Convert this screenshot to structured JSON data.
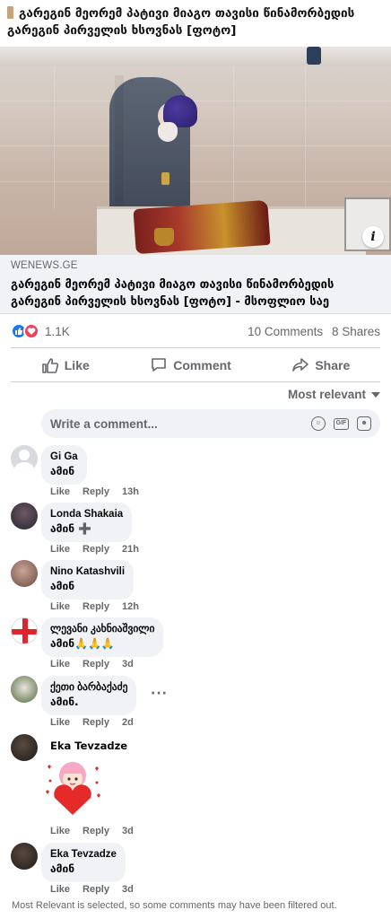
{
  "post": {
    "title": "გარეგინ მეორემ პატივი მიაგო თავისი წინამორბედის გარეგინ პირველის ხსოვნას [ფოტო]",
    "info_label": "i"
  },
  "link": {
    "domain": "WENEWS.GE",
    "title": "გარეგინ მეორემ პატივი მიაგო თავისი წინამორბედის გარეგინ პირველის ხსოვნას [ფოტო] - მსოფლიო საე"
  },
  "stats": {
    "reactions_count": "1.1K",
    "comments": "10 Comments",
    "shares": "8 Shares"
  },
  "actions": {
    "like": "Like",
    "comment": "Comment",
    "share": "Share"
  },
  "sort": {
    "label": "Most relevant"
  },
  "composer": {
    "placeholder": "Write a comment...",
    "gif_label": "GIF"
  },
  "comment_actions": {
    "like": "Like",
    "reply": "Reply"
  },
  "comments": [
    {
      "name": "Gi Ga",
      "text": "ამინ",
      "time": "13h"
    },
    {
      "name": "Londa Shakaia",
      "text": "ამინ ➕",
      "time": "21h"
    },
    {
      "name": "Nino Katashvili",
      "text": "ამინ",
      "time": "12h"
    },
    {
      "name": "ლევანი კახნიაშვილი",
      "text": "ამინ🙏🙏🙏",
      "time": "3d"
    },
    {
      "name": "ქეთი ბარბაქაძე",
      "text": "ამინ.",
      "time": "2d"
    },
    {
      "name": "Eka Tevzadze",
      "text": "",
      "time": "3d"
    },
    {
      "name": "Eka Tevzadze",
      "text": "ამინ",
      "time": "3d"
    }
  ],
  "more_label": "···",
  "footer": {
    "note": "Most Relevant is selected, so some comments may have been filtered out."
  },
  "colors": {
    "accent": "#1877f2",
    "love": "#f33e58",
    "muted": "#65676b",
    "bubble": "#f0f2f5"
  },
  "icons": [
    "like-reaction-icon",
    "love-reaction-icon",
    "thumbs-up-icon",
    "comment-icon",
    "share-icon",
    "emoji-icon",
    "gif-icon",
    "sticker-icon",
    "info-icon"
  ]
}
